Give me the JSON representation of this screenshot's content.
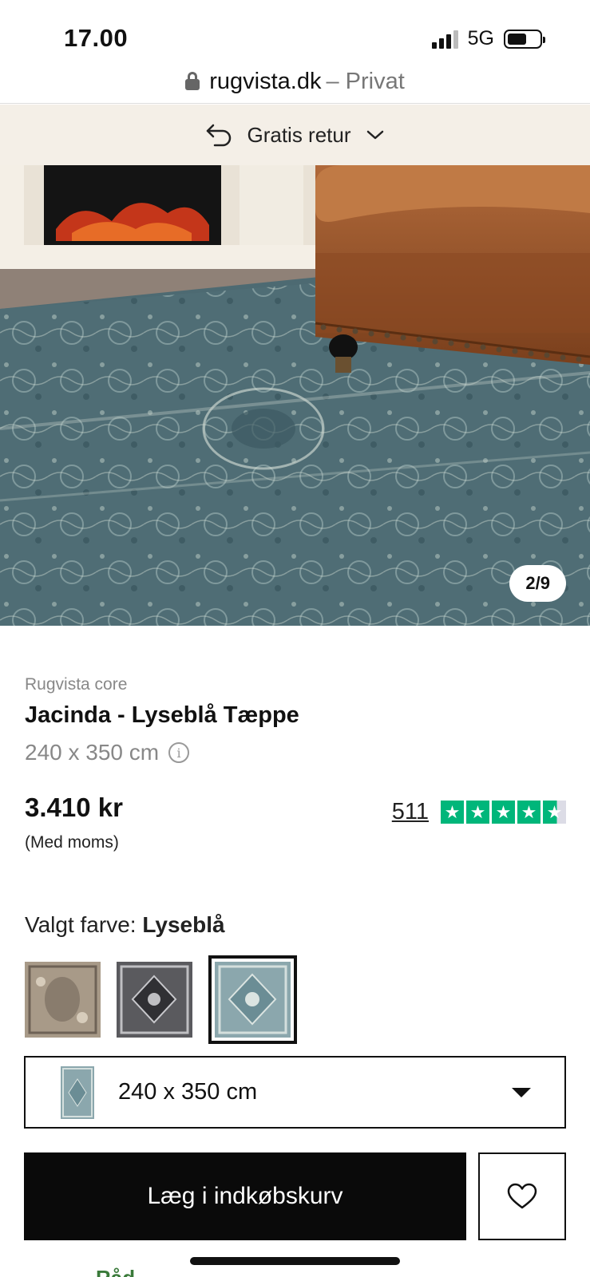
{
  "status_bar": {
    "time": "17.00",
    "network": "5G",
    "battery_level": 0.6
  },
  "browser": {
    "domain": "rugvista.dk",
    "suffix": "– Privat"
  },
  "banner": {
    "text": "Gratis retur"
  },
  "gallery": {
    "counter": "2/9"
  },
  "product": {
    "brand": "Rugvista core",
    "title": "Jacinda - Lyseblå Tæppe",
    "size": "240 x 350 cm",
    "price": "3.410 kr",
    "vat_note": "(Med moms)",
    "review_count": "511",
    "stars": 4.5
  },
  "color": {
    "label": "Valgt farve:",
    "selected": "Lyseblå",
    "swatches": [
      {
        "name": "beige",
        "color": "#a89a88"
      },
      {
        "name": "gray",
        "color": "#5a5a5e"
      },
      {
        "name": "light-blue",
        "color": "#8ba7ad"
      }
    ]
  },
  "size_select": {
    "value": "240 x 350 cm"
  },
  "actions": {
    "add_to_cart": "Læg i indkøbskurv"
  },
  "partial_text": "Råd"
}
